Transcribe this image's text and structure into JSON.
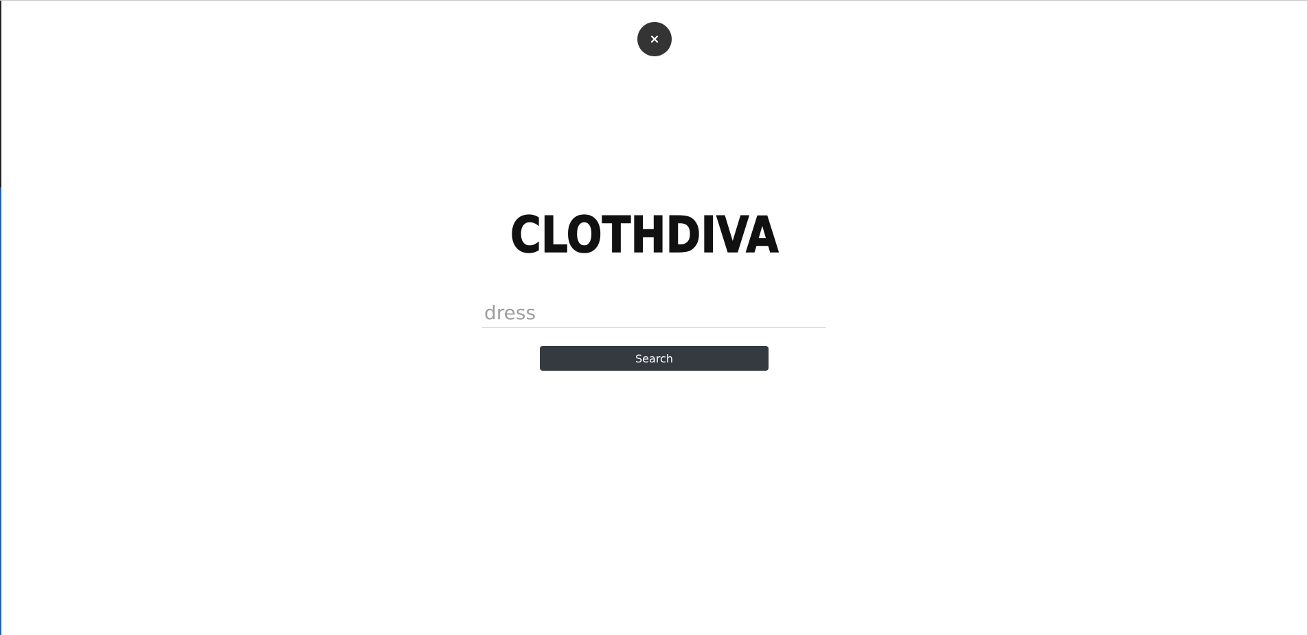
{
  "close": {
    "icon": "close-icon"
  },
  "logo": {
    "text": "CLOTHDIVA"
  },
  "search": {
    "placeholder": "dress",
    "value": "",
    "button_label": "Search"
  },
  "colors": {
    "button_bg": "#343a40",
    "close_bg": "#343434",
    "logo": "#111111"
  }
}
